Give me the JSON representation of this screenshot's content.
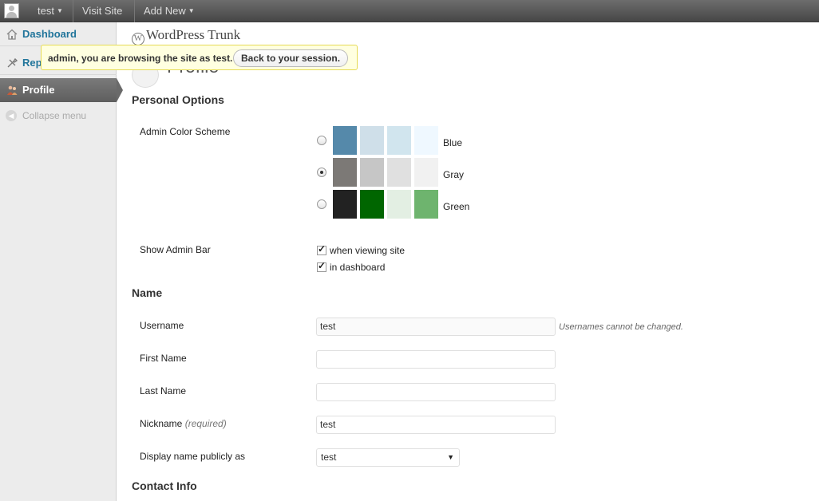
{
  "adminbar": {
    "user_label": "test",
    "visit_site": "Visit Site",
    "add_new": "Add New"
  },
  "sidebar": {
    "items": [
      {
        "label": "Dashboard"
      },
      {
        "label": "Rep"
      },
      {
        "label": "Profile"
      },
      {
        "label": "Collapse menu"
      }
    ]
  },
  "header": {
    "site_title": "WordPress Trunk",
    "page_title": "Profile"
  },
  "notice": {
    "message": "admin, you are browsing the site as test.",
    "button": "Back to your session."
  },
  "personal_options": {
    "heading": "Personal Options",
    "color_scheme_label": "Admin Color Scheme",
    "schemes": [
      {
        "name": "Blue",
        "checked": false,
        "colors": [
          "#5589aa",
          "#cfdfe9",
          "#d1e5ee",
          "#eff8ff"
        ]
      },
      {
        "name": "Gray",
        "checked": true,
        "colors": [
          "#7c7976",
          "#c6c6c6",
          "#e0e0e0",
          "#f1f1f1"
        ]
      },
      {
        "name": "Green",
        "checked": false,
        "colors": [
          "#222222",
          "#006600",
          "#e3efe3",
          "#6eb46e"
        ]
      }
    ],
    "admin_bar_label": "Show Admin Bar",
    "admin_bar_options": [
      "when viewing site",
      "in dashboard"
    ]
  },
  "name_section": {
    "heading": "Name",
    "username_label": "Username",
    "username_value": "test",
    "username_desc": "Usernames cannot be changed.",
    "first_name_label": "First Name",
    "first_name_value": "",
    "last_name_label": "Last Name",
    "last_name_value": "",
    "nickname_label": "Nickname",
    "nickname_required": "(required)",
    "nickname_value": "test",
    "display_name_label": "Display name publicly as",
    "display_name_value": "test"
  },
  "contact": {
    "heading": "Contact Info"
  }
}
